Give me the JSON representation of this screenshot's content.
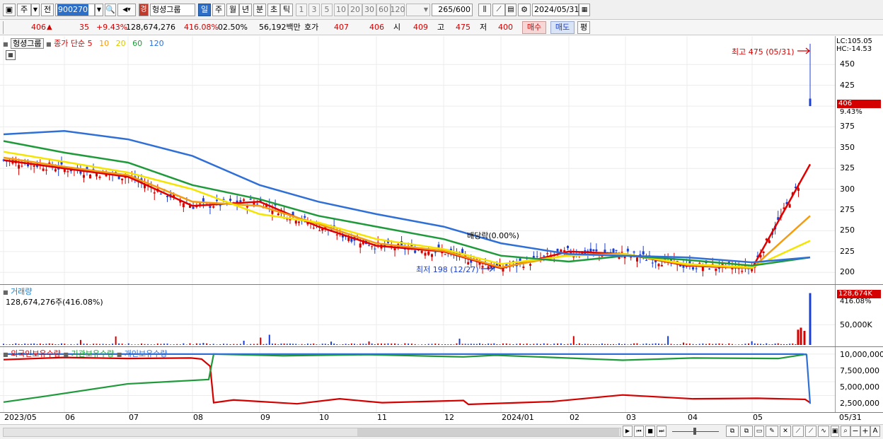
{
  "toolbar": {
    "market_label": "주",
    "prev_label": "전",
    "code": "900270",
    "stock_name_badge": "경",
    "stock_name": "헝셩그룹",
    "period_tabs": [
      "일",
      "주",
      "월",
      "년",
      "분",
      "초",
      "틱"
    ],
    "interval_buttons": [
      "1",
      "3",
      "5",
      "10",
      "20",
      "30",
      "60",
      "120"
    ],
    "count_display": "265",
    "count_total": "/600",
    "date": "2024/05/31"
  },
  "quote": {
    "price": "406",
    "arrow": "▲",
    "change": "35",
    "change_pct": "+9.43%",
    "volume": "128,674,276",
    "volume_ratio": "416.08%",
    "turnover": "02.50%",
    "amount": "56,192백만",
    "hoga_label": "호가",
    "ask": "407",
    "bid": "406",
    "open_label": "시",
    "open": "409",
    "high_label": "고",
    "high": "475",
    "low_label": "저",
    "low": "400",
    "buy_label": "매수",
    "sell_label": "매도",
    "eval_label": "평"
  },
  "price_legend": {
    "name": "헝셩그룹",
    "ma_label": "종가 단순",
    "ma": [
      {
        "label": "5",
        "color": "#e00000"
      },
      {
        "label": "10",
        "color": "#f39c12"
      },
      {
        "label": "20",
        "color": "#f4e400"
      },
      {
        "label": "60",
        "color": "#1e9a3a"
      },
      {
        "label": "120",
        "color": "#2f6fd6"
      }
    ]
  },
  "price_axis": {
    "lc": "LC:105.05",
    "hc": "HC:-14.53",
    "ticks": [
      "450",
      "425",
      "400",
      "375",
      "350",
      "325",
      "300",
      "275",
      "250",
      "225",
      "200"
    ],
    "current": "406",
    "current_pct": "9.43%"
  },
  "annotations": {
    "high": "최고 475 (05/31)",
    "low": "최저 198 (12/27)",
    "dividend": "배당락(0.00%)"
  },
  "volume_panel": {
    "title": "거래량",
    "value": "128,674,276주(416.08%)",
    "badge": "128,674K",
    "badge_pct": "416.08%",
    "tick": "50,000K"
  },
  "holdings_panel": {
    "legend": [
      "외국인보유수량",
      "기관보유수량",
      "개인보유수량"
    ],
    "legend_colors": [
      "#d40000",
      "#1e9a3a",
      "#2f6fd6"
    ],
    "ticks": [
      "10,000,000",
      "7,500,000",
      "5,000,000",
      "2,500,000"
    ]
  },
  "x_axis": {
    "labels": [
      "2023/05",
      "06",
      "07",
      "08",
      "09",
      "10",
      "11",
      "12",
      "2024/01",
      "02",
      "03",
      "04",
      "05"
    ],
    "right_label": "05/31"
  },
  "chart_data": {
    "type": "line",
    "title": "",
    "x": [
      "2023/05",
      "06",
      "07",
      "08",
      "09",
      "10",
      "11",
      "12",
      "2024/01",
      "02",
      "03",
      "04",
      "05",
      "05/31"
    ],
    "series": [
      {
        "name": "5",
        "values": [
          335,
          325,
          315,
          280,
          285,
          255,
          232,
          225,
          205,
          225,
          222,
          208,
          205,
          330
        ]
      },
      {
        "name": "10",
        "values": [
          338,
          327,
          317,
          285,
          280,
          258,
          235,
          226,
          206,
          221,
          222,
          209,
          205,
          268
        ]
      },
      {
        "name": "20",
        "values": [
          345,
          333,
          320,
          300,
          270,
          260,
          240,
          228,
          210,
          220,
          222,
          210,
          206,
          238
        ]
      },
      {
        "name": "60",
        "values": [
          358,
          344,
          332,
          305,
          288,
          268,
          255,
          240,
          220,
          213,
          220,
          215,
          208,
          218
        ]
      },
      {
        "name": "120",
        "values": [
          366,
          370,
          360,
          340,
          305,
          285,
          270,
          255,
          235,
          222,
          220,
          218,
          212,
          218
        ]
      }
    ],
    "ylim": [
      190,
      480
    ],
    "y_ticks": [
      200,
      225,
      250,
      275,
      300,
      325,
      350,
      375,
      400,
      425,
      450
    ],
    "volume": {
      "max_value_k": 128674,
      "tick_k": 50000
    },
    "holdings": {
      "ylim": [
        0,
        10500000
      ],
      "series_order": [
        "외국인보유수량",
        "기관보유수량",
        "개인보유수량"
      ]
    }
  }
}
